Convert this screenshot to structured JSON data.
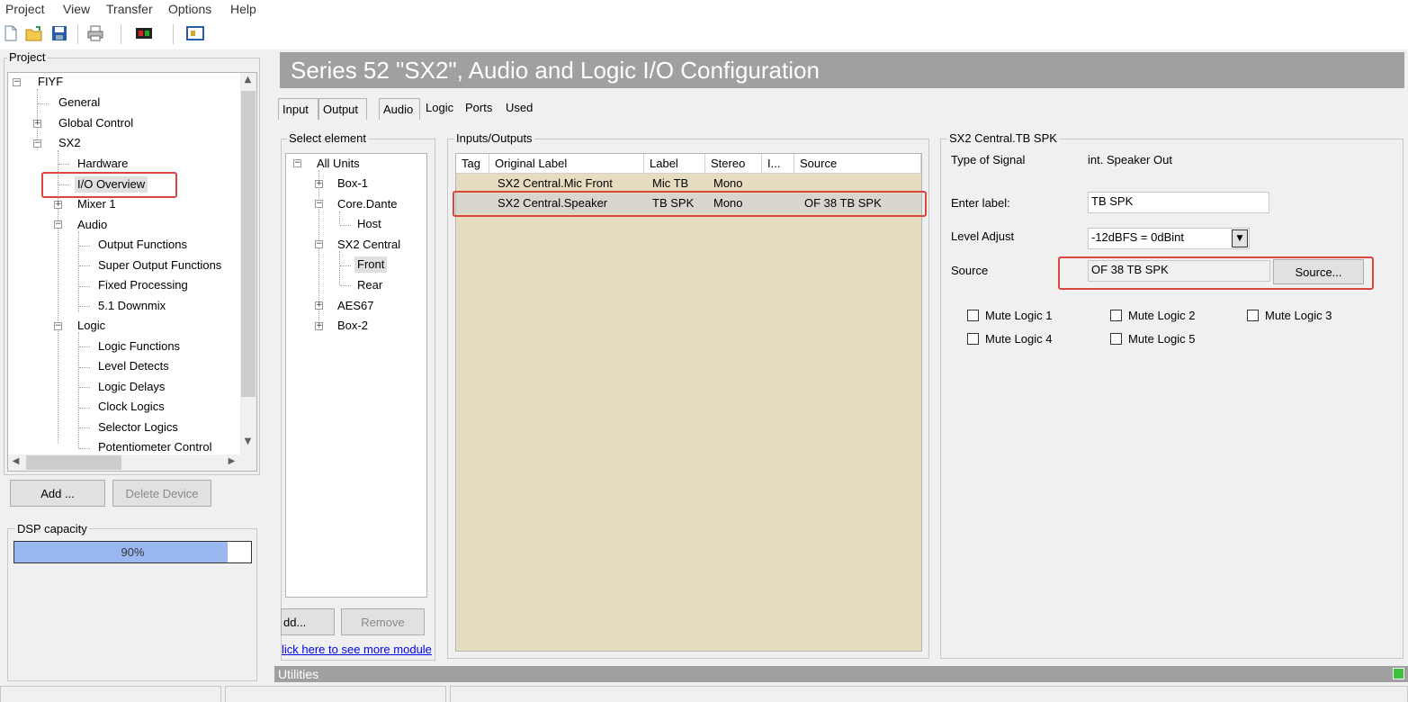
{
  "menu": [
    "Project",
    "View",
    "Transfer",
    "Options",
    "Help"
  ],
  "toolbar": {
    "icons": [
      "new-file-icon",
      "open-folder-icon",
      "save-icon",
      "print-icon",
      "device-icon",
      "window-icon"
    ]
  },
  "project_panel": {
    "title": "Project",
    "tree": [
      {
        "label": "FIYF"
      },
      {
        "label": "General"
      },
      {
        "label": "Global Control"
      },
      {
        "label": "SX2"
      },
      {
        "label": "Hardware"
      },
      {
        "label": "I/O Overview"
      },
      {
        "label": "Mixer 1"
      },
      {
        "label": "Audio"
      },
      {
        "label": "Output Functions"
      },
      {
        "label": "Super Output Functions"
      },
      {
        "label": "Fixed Processing"
      },
      {
        "label": "5.1 Downmix"
      },
      {
        "label": "Logic"
      },
      {
        "label": "Logic Functions"
      },
      {
        "label": "Level Detects"
      },
      {
        "label": "Logic Delays"
      },
      {
        "label": "Clock Logics"
      },
      {
        "label": "Selector Logics"
      },
      {
        "label": "Potentiometer Control"
      }
    ],
    "add_button": "Add ...",
    "delete_button": "Delete Device"
  },
  "dsp": {
    "title": "DSP capacity",
    "value_label": "90%",
    "fraction": 0.9
  },
  "banner": {
    "title": "Series 52 \"SX2\", Audio and Logic I/O  Configuration"
  },
  "tabs": {
    "input": "Input",
    "output": "Output",
    "audio": "Audio",
    "logic": "Logic",
    "ports": "Ports",
    "used": "Used"
  },
  "select_element": {
    "title": "Select element",
    "tree": [
      {
        "label": "All Units"
      },
      {
        "label": "Box-1"
      },
      {
        "label": "Core.Dante"
      },
      {
        "label": "Host"
      },
      {
        "label": "SX2 Central"
      },
      {
        "label": "Front"
      },
      {
        "label": "Rear"
      },
      {
        "label": "AES67"
      },
      {
        "label": "Box-2"
      }
    ],
    "add_button": "dd...",
    "remove_button": "Remove",
    "link": "lick here to see more module"
  },
  "io": {
    "title": "Inputs/Outputs",
    "columns": [
      "Tag",
      "Original Label",
      "Label",
      "Stereo",
      "I...",
      "Source"
    ],
    "rows": [
      {
        "tag": "",
        "original": "SX2 Central.Mic Front",
        "label": "Mic TB",
        "stereo": "Mono",
        "i": "",
        "source": ""
      },
      {
        "tag": "",
        "original": "SX2 Central.Speaker",
        "label": "TB SPK",
        "stereo": "Mono",
        "i": "",
        "source": "OF 38 TB SPK"
      }
    ]
  },
  "detail": {
    "title": "SX2 Central.TB SPK",
    "type_label": "Type of Signal",
    "type_value": "int. Speaker Out",
    "enter_label": "Enter label:",
    "label_value": "TB SPK",
    "level_label": "Level Adjust",
    "level_value": "-12dBFS = 0dBint",
    "source_label": "Source",
    "source_value": "OF 38 TB SPK",
    "source_button": "Source...",
    "mute_logics": [
      "Mute Logic 1",
      "Mute Logic 2",
      "Mute Logic 3",
      "Mute Logic 4",
      "Mute Logic 5"
    ]
  },
  "utilities": {
    "label": "Utilities"
  },
  "colors": {
    "banner": "#a0a0a0",
    "grid_bg": "#e6dcc0",
    "highlight": "#d9463e",
    "dsp_fill": "#9ab8f0"
  }
}
